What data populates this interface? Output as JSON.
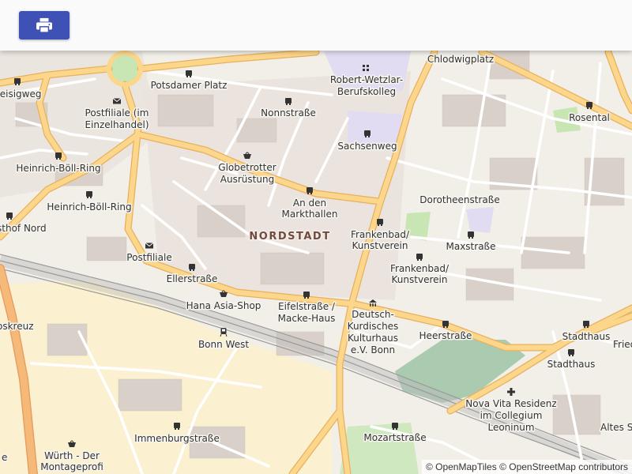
{
  "toolbar": {
    "print_icon": "printer-icon"
  },
  "map": {
    "district": "NORDSTADT",
    "labels": {
      "zeisigweg": "Zeisigweg",
      "postfiliale_line1": "Postfiliale (im",
      "postfiliale_line2": "Einzelhandel)",
      "potsdamer_platz": "Potsdamer Platz",
      "nonnstrasse": "Nonnstraße",
      "wetzlar_line1": "Robert-Wetzlar-",
      "wetzlar_line2": "Berufskolleg",
      "chlodwigplatz": "Chlodwigplatz",
      "rosental": "Rosental",
      "sachsenweg": "Sachsenweg",
      "heinrich_boell_1": "Heinrich-Böll-Ring",
      "heinrich_boell_2": "Heinrich-Böll-Ring",
      "globetrotter_line1": "Globetrotter",
      "globetrotter_line2": "Ausrüstung",
      "an_den_line1": "An den",
      "an_den_line2": "Markthallen",
      "dorotheenstrasse": "Dorotheenstraße",
      "hof_nord": "sthof Nord",
      "frankenbad1_line1": "Frankenbad/",
      "frankenbad1_line2": "Kunstverein",
      "maxstrasse": "Maxstraße",
      "postfiliale2": "Postfiliale",
      "frankenbad2_line1": "Frankenbad/",
      "frankenbad2_line2": "Kunstverein",
      "ellerstrasse": "Ellerstraße",
      "hana": "Hana Asia-Shop",
      "eifel_line1": "Eifelstraße /",
      "eifel_line2": "Macke-Haus",
      "deutsch_line1": "Deutsch-",
      "deutsch_line2": "Kurdisches",
      "deutsch_line3": "Kulturhaus",
      "deutsch_line4": "e.V. Bonn",
      "heerstrasse": "Heerstraße",
      "stadthaus1": "Stadthaus",
      "stadthaus2": "Stadthaus",
      "fried": "Fried",
      "bonn_west": "Bonn West",
      "kreuz": "oskreuz",
      "novavita_line1": "Nova Vita Residenz",
      "novavita_line2": "im Collegium",
      "novavita_line3": "Leoninum",
      "altes": "Altes St",
      "immenburg": "Immenburgstraße",
      "mozart": "Mozartstraße",
      "wuerth_line1": "Würth - Der",
      "wuerth_line2": "Montageprofi",
      "edge_e": "e"
    }
  },
  "attribution": {
    "prefix": "©",
    "tiles": "OpenMapTiles",
    "separator": "©",
    "osm": "OpenStreetMap contributors"
  },
  "colors": {
    "background": "#f2efe9",
    "building": "#d9d0c9",
    "major_road": "#fcd68a",
    "major_casing": "#e8b05e",
    "minor_road": "#ffffff",
    "rail": "#999999",
    "park": "#c8e6b4",
    "cemetery": "#aacbaf",
    "school": "#e2dcf2",
    "industrial": "#fbf0cf",
    "button": "#3f51b5",
    "district_label": "#734a40"
  }
}
